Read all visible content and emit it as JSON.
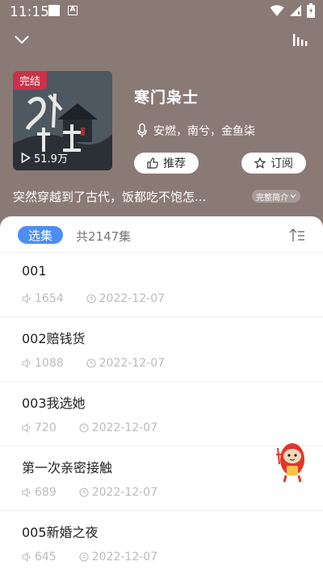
{
  "status": {
    "time": "11:15",
    "a_label": "A"
  },
  "header": {
    "back_icon": "chevron-down-icon",
    "equalizer_icon": "equalizer-icon"
  },
  "album": {
    "badge": "完结",
    "plays": "51.9万",
    "title": "寒门枭士",
    "artists": "安燃，南兮，金鱼柒",
    "recommend_label": "推荐",
    "subscribe_label": "订阅",
    "description": "突然穿越到了古代，饭都吃不饱怎...",
    "intro_label": "完整简介"
  },
  "tabs": {
    "select_label": "选集",
    "count_label": "共2147集"
  },
  "episodes": [
    {
      "title": "001",
      "plays": "1654",
      "date": "2022-12-07"
    },
    {
      "title": "002赔钱货",
      "plays": "1088",
      "date": "2022-12-07"
    },
    {
      "title": "003我选她",
      "plays": "720",
      "date": "2022-12-07"
    },
    {
      "title": "第一次亲密接触",
      "plays": "689",
      "date": "2022-12-07"
    },
    {
      "title": "005新婚之夜",
      "plays": "645",
      "date": "2022-12-07"
    }
  ],
  "colors": {
    "header_bg": "#8a7a76",
    "badge": "#c9324a",
    "accent_blue": "#4c8ef2"
  }
}
